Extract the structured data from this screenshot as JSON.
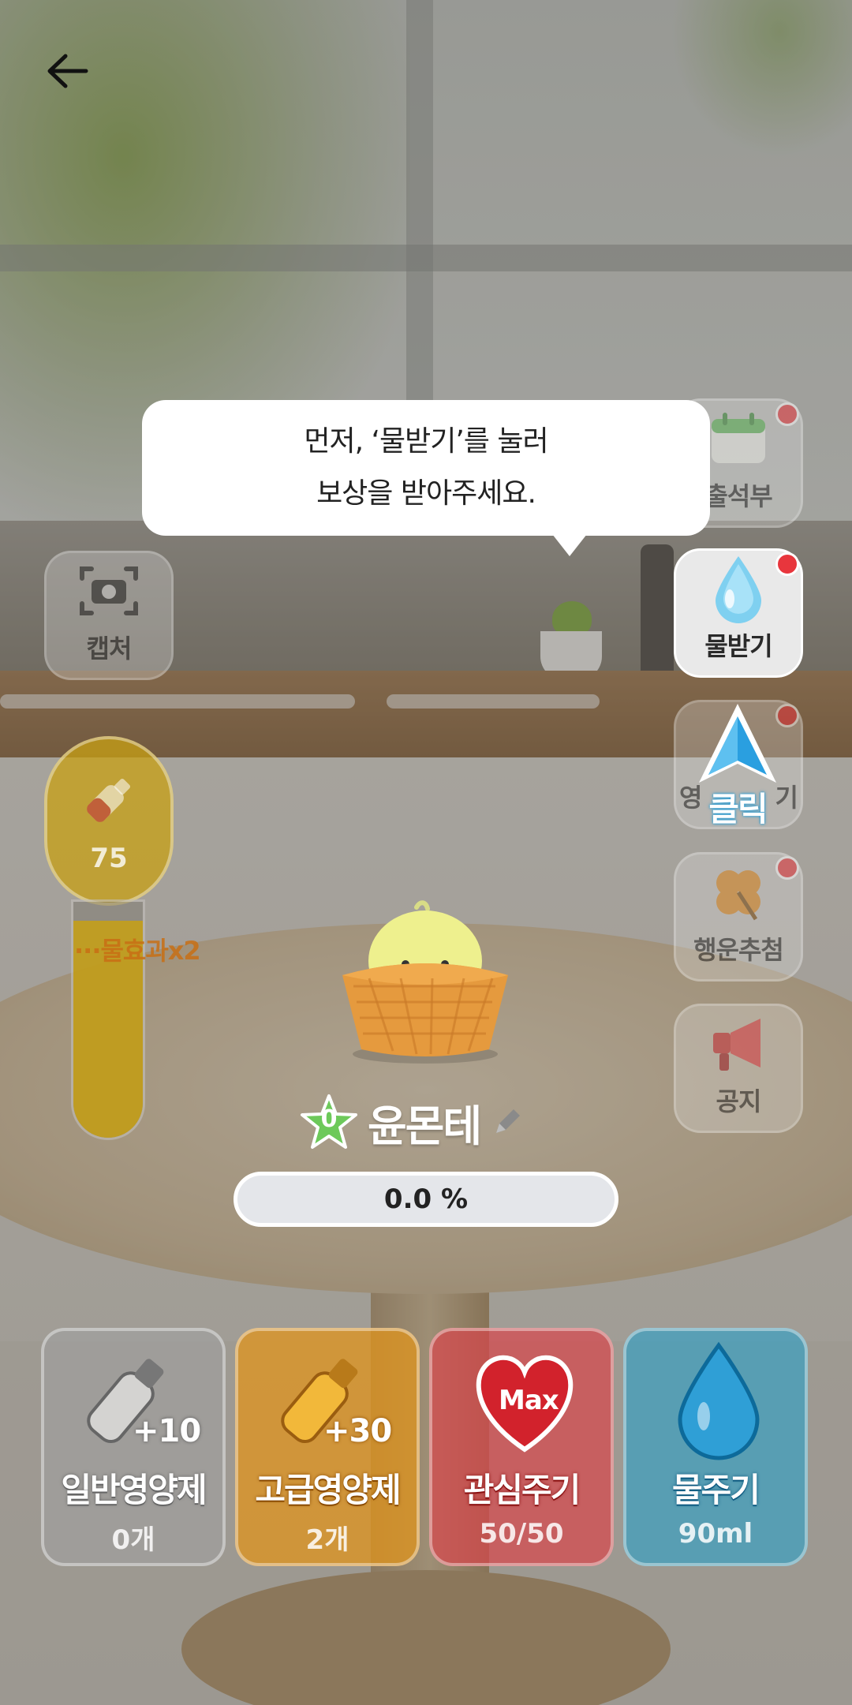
{
  "tooltip": {
    "line1": "먼저, ‘물받기’를 눌러",
    "line2": "보상을 받아주세요."
  },
  "side_menu": {
    "capture": {
      "label": "캡처",
      "icon": "camera-icon"
    },
    "attendance": {
      "label": "출석부",
      "icon": "calendar-icon"
    },
    "water_receive": {
      "label": "물받기",
      "icon": "water-drop-icon"
    },
    "nutrient_receive": {
      "label_left": "영",
      "label_right": "기",
      "icon": "nutrient-icon"
    },
    "lucky_draw": {
      "label": "행운추첨",
      "icon": "clover-icon"
    },
    "notice": {
      "label": "공지",
      "icon": "megaphone-icon"
    }
  },
  "click_hint": {
    "label": "클릭"
  },
  "nutrient_gauge": {
    "value": "75",
    "effect_label": "물효과x2",
    "fill_fraction": 0.92
  },
  "plant": {
    "level": "0",
    "name": "윤몬테",
    "progress": "0.0 %"
  },
  "cards": [
    {
      "title": "일반영양제",
      "sub": "0개",
      "bonus": "+10",
      "color": "#9a9a9a",
      "icon": "bottle-icon"
    },
    {
      "title": "고급영양제",
      "sub": "2개",
      "bonus": "+30",
      "color": "#e0941c",
      "icon": "golden-bottle-icon"
    },
    {
      "title": "관심주기",
      "sub": "50/50",
      "badge": "Max",
      "color": "#d8464c",
      "icon": "heart-icon"
    },
    {
      "title": "물주기",
      "sub": "90ml",
      "color": "#3b9fc2",
      "icon": "water-drop-icon"
    }
  ],
  "colors": {
    "red_dot": "#e8363d",
    "accent_blue": "#1e9ad6"
  }
}
